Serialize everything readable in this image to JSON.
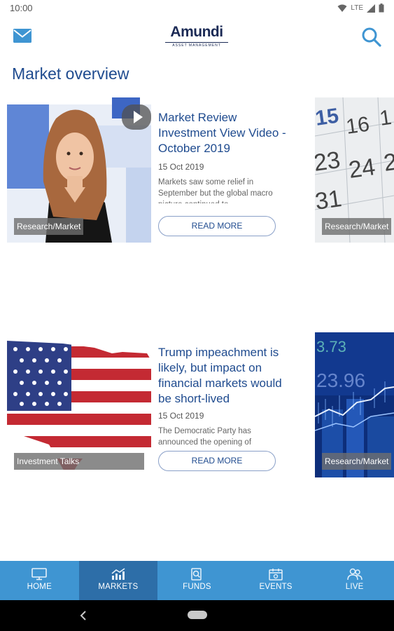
{
  "status": {
    "time": "10:00",
    "network": "LTE"
  },
  "header": {
    "logo_text": "Amundi",
    "logo_subtitle": "ASSET MANAGEMENT",
    "mail_icon": "mail-icon",
    "search_icon": "search-icon"
  },
  "page": {
    "title": "Market overview"
  },
  "articles": [
    {
      "title": "Market Review Investment View Video - October 2019",
      "date": "15 Oct 2019",
      "excerpt": "Markets saw some relief in September but the global macro picture continued to",
      "tag": "Research/Market",
      "cta": "READ MORE",
      "media": "video"
    },
    {
      "title": "Trump impeachment is likely, but impact on financial markets would be short-lived",
      "date": "15 Oct 2019",
      "excerpt": "The Democratic Party has announced the opening of",
      "tag": "Investment Talks",
      "cta": "READ MORE",
      "media": "image"
    }
  ],
  "side_cards": [
    {
      "tag": "Research/Market"
    },
    {
      "tag": "Research/Market"
    }
  ],
  "bottom_nav": [
    {
      "label": "HOME",
      "icon": "monitor-icon",
      "active": false
    },
    {
      "label": "MARKETS",
      "icon": "chart-icon",
      "active": true
    },
    {
      "label": "FUNDS",
      "icon": "fund-search-icon",
      "active": false
    },
    {
      "label": "EVENTS",
      "icon": "calendar-icon",
      "active": false
    },
    {
      "label": "LIVE",
      "icon": "people-icon",
      "active": false
    }
  ],
  "colors": {
    "accent": "#1f4b8f",
    "nav_bg": "#3f95d2",
    "nav_active": "#2d6ea8"
  }
}
